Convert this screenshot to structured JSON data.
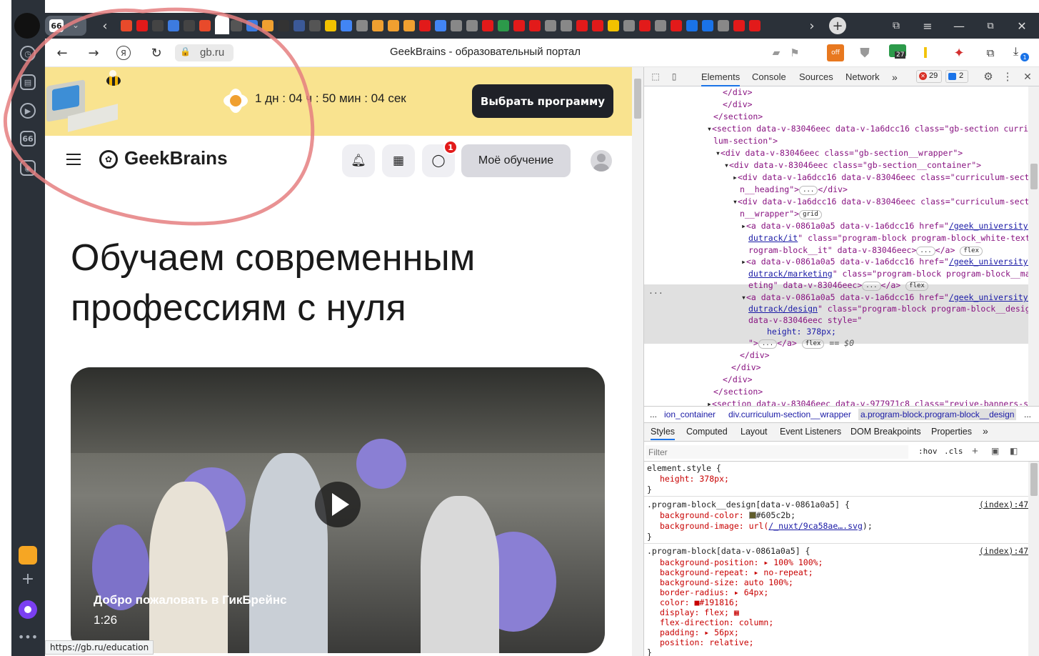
{
  "browser": {
    "tab_counter": "66",
    "sidebar_badge": "66",
    "url": "gb.ru",
    "page_title": "GeekBrains - образовательный портал",
    "status_url": "https://gb.ru/education",
    "ext_badge_27": "27",
    "download_badge": "1"
  },
  "promo": {
    "timer": "1 дн : 04 ч : 50 мин : 04 сек",
    "cta_label": "Выбрать программу"
  },
  "header": {
    "logo_text": "GeekBrains",
    "chat_badge": "1",
    "learning_label": "Моё обучение"
  },
  "hero": {
    "headline_line1": "Обучаем современным",
    "headline_line2": "профессиям с нуля",
    "video_title": "Добро пожаловать в ГикБрейнс",
    "video_duration": "1:26"
  },
  "devtools": {
    "tabs": [
      "Elements",
      "Console",
      "Sources",
      "Network"
    ],
    "errors": "29",
    "messages": "2",
    "breadcrumbs": [
      "...",
      "ion_container",
      "div.curriculum-section__wrapper",
      "a.program-block.program-block__design",
      "..."
    ],
    "style_tabs": [
      "Styles",
      "Computed",
      "Layout",
      "Event Listeners",
      "DOM Breakpoints",
      "Properties"
    ],
    "filter_placeholder": "Filter",
    "hov": ":hov",
    "cls": ".cls",
    "selected_marker": "== $0",
    "ellipsis": "...",
    "dom": [
      "</div>",
      "</div>",
      "</section>",
      "<section data-v-83046eec data-v-1a6dcc16 class=\"gb-section curricu",
      "lum-section\">",
      "<div data-v-83046eec class=\"gb-section__wrapper\">",
      "<div data-v-83046eec class=\"gb-section__container\">",
      "<div data-v-1a6dcc16 data-v-83046eec class=\"curriculum-sectio",
      "n__heading\">",
      "</div>",
      "<div data-v-1a6dcc16 data-v-83046eec class=\"curriculum-sectio",
      "n__wrapper\">",
      "grid",
      "<a data-v-0861a0a5 data-v-1a6dcc16 href=\"",
      "/geek_university/e",
      "dutrack/it",
      "\" class=\"program-block program-block_white-text p",
      "rogram-block__it\" data-v-83046eec>",
      "</a>",
      "flex",
      "/geek_university/e",
      "dutrack/marketing",
      "\" class=\"program-block program-block__mark",
      "eting\" data-v-83046eec>",
      "/geek_university/e",
      "dutrack/design",
      "\" class=\"program-block program-block__design\"",
      "data-v-83046eec style=\"",
      "height: 378px;",
      "\">",
      "</div>",
      "</div>",
      "</section>",
      "<section data-v-83046eec data-v-977971c8 class=\"revive-banners-sec"
    ],
    "styles": {
      "element_style": "element.style {",
      "height_decl": "height: 378px;",
      "close": "}",
      "rule1_selector": ".program-block__design[data-v-0861a0a5] {",
      "rule1_src": "(index):47",
      "rule1_bgcolor": "background-color: ",
      "rule1_bgcolor_val": "#605c2b;",
      "rule1_bgimg": "background-image: url(",
      "rule1_bgimg_link": "/_nuxt/9ca58ae….svg",
      "rule1_bgimg_end": ");",
      "rule2_selector": ".program-block[data-v-0861a0a5] {",
      "rule2_src": "(index):47",
      "decls": [
        "background-position: ▸ 100% 100%;",
        "background-repeat: ▸ no-repeat;",
        "background-size: auto 100%;",
        "border-radius: ▸ 64px;",
        "color: ■#191816;",
        "display: flex; ▦",
        "flex-direction: column;",
        "padding: ▸ 56px;",
        "position: relative;"
      ]
    }
  },
  "colors": {
    "promo_bg": "#f9e38f",
    "cta_bg": "#1f2128",
    "annotation_circle": "#e57f80",
    "badge_red": "#e21a1a",
    "chrome_dark": "#2b3139"
  }
}
